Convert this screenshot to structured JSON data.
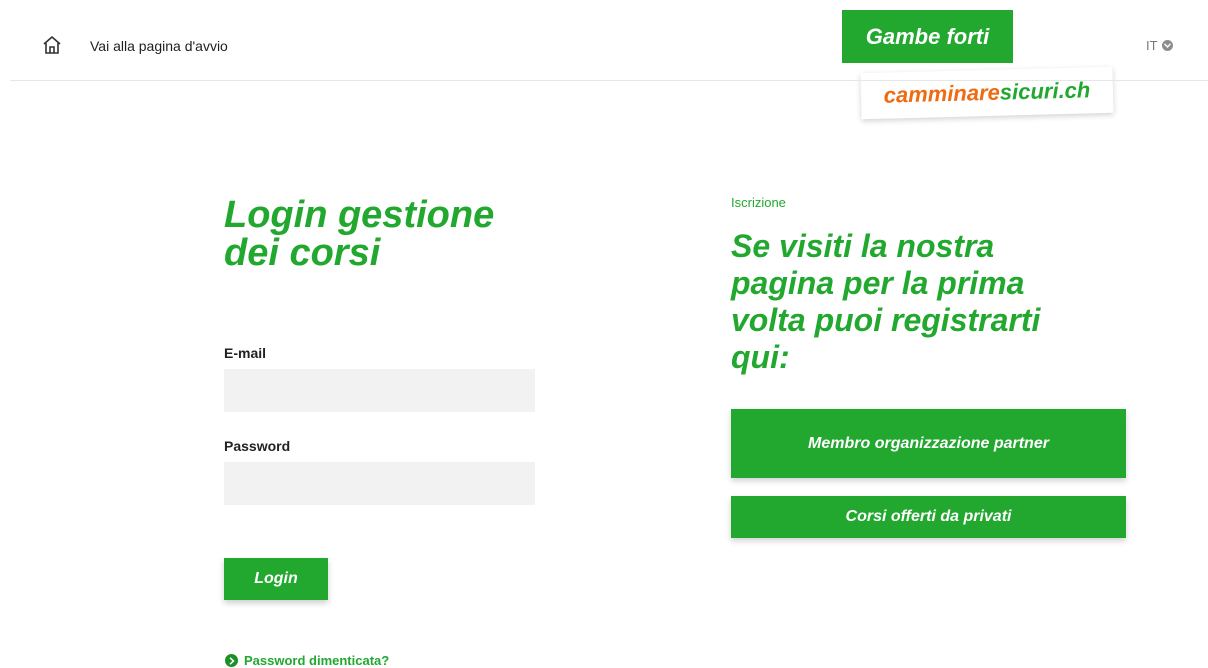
{
  "header": {
    "home_link": "Vai alla pagina d'avvio",
    "language": "IT",
    "logo_top": "Gambe forti",
    "logo_bottom_a": "camminare",
    "logo_bottom_b": "sicuri.ch"
  },
  "login": {
    "title": "Login gestione dei corsi",
    "email_label": "E-mail",
    "email_value": "",
    "password_label": "Password",
    "password_value": "",
    "login_button": "Login",
    "forgot_link": "Password dimenticata?"
  },
  "registration": {
    "kicker": "Iscrizione",
    "title": "Se visiti la nostra pagina per la prima volta puoi registrarti qui:",
    "button_partner": "Membro organizzazione partner",
    "button_private": "Corsi offerti da privati"
  },
  "colors": {
    "brand_green": "#22a82f",
    "brand_orange": "#f06a12",
    "input_bg": "#f2f2f2"
  }
}
